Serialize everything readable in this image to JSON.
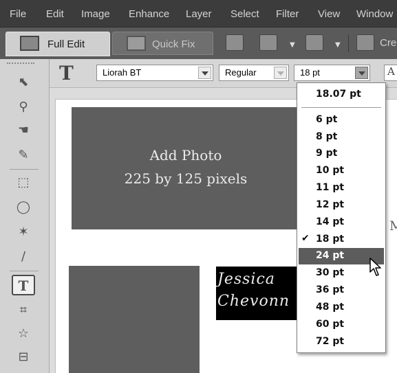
{
  "menubar": {
    "items": [
      "File",
      "Edit",
      "Image",
      "Enhance",
      "Layer",
      "Select",
      "Filter",
      "View",
      "Window"
    ]
  },
  "tabs": {
    "full_edit": "Full Edit",
    "quick_fix": "Quick Fix",
    "create_partial": "Cre"
  },
  "options": {
    "font_family": "Liorah BT",
    "font_style": "Regular",
    "font_size": "18 pt",
    "aa_label": "A"
  },
  "canvas": {
    "photo_line1": "Add Photo",
    "photo_line2": "225 by 125 pixels",
    "name_line1": "Jessica",
    "name_line2": "Chevonn",
    "edge_letter": "M"
  },
  "dropdown": {
    "current_value": "18.07 pt",
    "items": [
      "6 pt",
      "8 pt",
      "9 pt",
      "10 pt",
      "11 pt",
      "12 pt",
      "14 pt",
      "18 pt",
      "24 pt",
      "30 pt",
      "36 pt",
      "48 pt",
      "60 pt",
      "72 pt"
    ],
    "checked_item": "18 pt",
    "highlighted_item": "24 pt",
    "check_glyph": "✔"
  },
  "colors": {
    "menubar_bg": "#3c3c3c",
    "highlight": "#5c5c5c",
    "placeholder_box": "#5e5e5e"
  }
}
